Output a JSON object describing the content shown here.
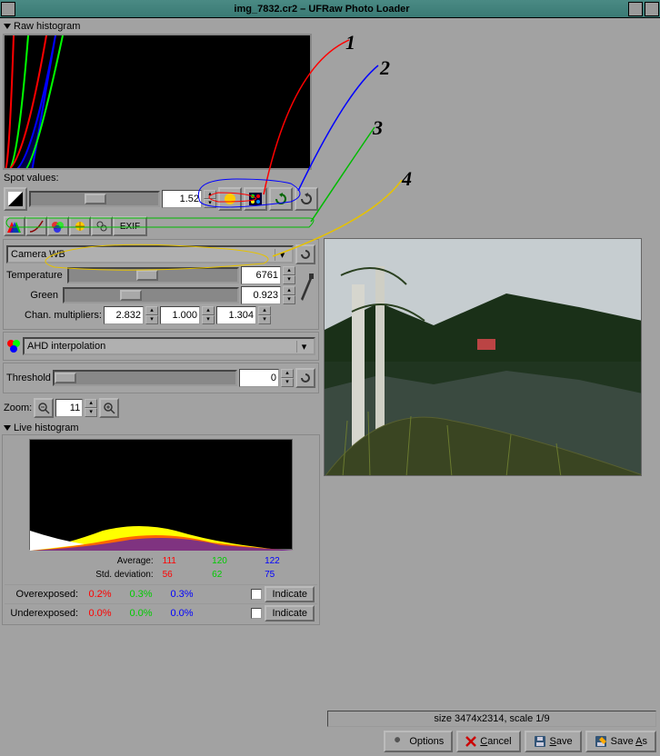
{
  "window": {
    "title": "img_7832.cr2 – UFRaw Photo Loader"
  },
  "annotations": [
    "1",
    "2",
    "3",
    "4"
  ],
  "raw_histogram": {
    "title": "Raw histogram"
  },
  "spot": {
    "label": "Spot values:"
  },
  "exposure": {
    "value": "1.52"
  },
  "tabs": {
    "exif_label": "EXIF"
  },
  "wb": {
    "preset": "Camera WB",
    "temperature_label": "Temperature",
    "temperature": "6761",
    "green_label": "Green",
    "green": "0.923",
    "chan_label": "Chan. multipliers:",
    "chan_r": "2.832",
    "chan_g": "1.000",
    "chan_b": "1.304"
  },
  "interp": {
    "label": "AHD interpolation"
  },
  "threshold": {
    "label": "Threshold",
    "value": "0"
  },
  "zoom": {
    "label": "Zoom:",
    "value": "11"
  },
  "live_histogram": {
    "title": "Live histogram"
  },
  "stats": {
    "average_label": "Average:",
    "stdev_label": "Std. deviation:",
    "over_label": "Overexposed:",
    "under_label": "Underexposed:",
    "avg_r": "111",
    "avg_g": "120",
    "avg_b": "122",
    "std_r": "56",
    "std_g": "62",
    "std_b": "75",
    "over_r": "0.2%",
    "over_g": "0.3%",
    "over_b": "0.3%",
    "under_r": "0.0%",
    "under_g": "0.0%",
    "under_b": "0.0%",
    "indicate_label": "Indicate"
  },
  "footer": {
    "size": "size 3474x2314, scale 1/9",
    "options": "Options",
    "cancel": "Cancel",
    "save": "Save",
    "save_as": "Save As"
  }
}
